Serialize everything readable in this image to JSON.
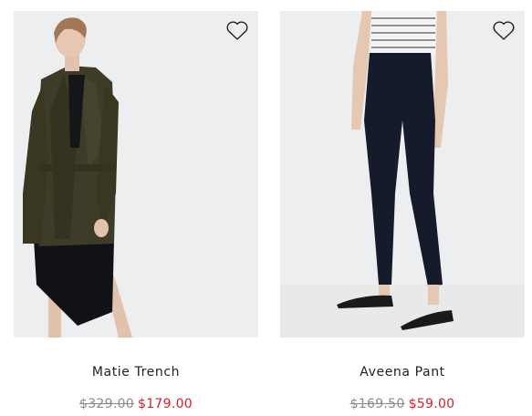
{
  "products": [
    {
      "name": "Matie Trench",
      "original_price": "$329.00",
      "sale_price": "$179.00",
      "wishlist_icon": "heart-outline-icon",
      "image": "model-wearing-olive-trench-coat"
    },
    {
      "name": "Aveena Pant",
      "original_price": "$169.50",
      "sale_price": "$59.00",
      "wishlist_icon": "heart-outline-icon",
      "image": "model-wearing-navy-cropped-pants"
    }
  ],
  "colors": {
    "sale": "#d0232f",
    "original": "#8a8a8a",
    "text": "#222222",
    "image_bg": "#eceeef"
  }
}
